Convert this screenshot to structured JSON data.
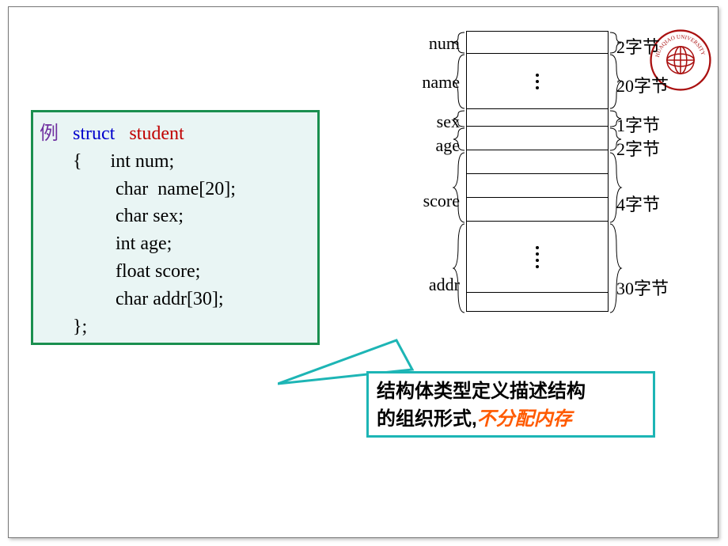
{
  "code": {
    "exampleLabel": "例",
    "kwStruct": "struct",
    "kwName": "student",
    "open": "{",
    "lines": [
      "int num;",
      "char  name[20];",
      "char sex;",
      "int age;",
      "float score;",
      "char addr[30];"
    ],
    "close": "};"
  },
  "fields": [
    {
      "name": "num",
      "size": "2字节"
    },
    {
      "name": "name",
      "size": "20字节"
    },
    {
      "name": "sex",
      "size": "1字节"
    },
    {
      "name": "age",
      "size": "2字节"
    },
    {
      "name": "score",
      "size": "4字节"
    },
    {
      "name": "addr",
      "size": "30字节"
    }
  ],
  "note": {
    "line1": "结构体类型定义描述结构",
    "line2a": "的组织形式,",
    "line2b": "不分配内存"
  },
  "logoText": "HUAQIAO UNIVERSITY"
}
